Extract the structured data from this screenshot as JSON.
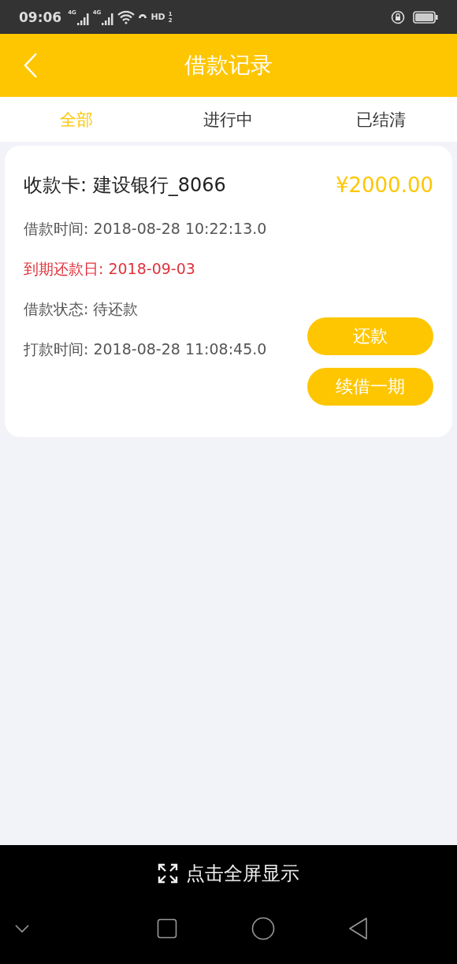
{
  "status_bar": {
    "time": "09:06",
    "signals": [
      "4G",
      "4G"
    ],
    "hd": "HD",
    "hd_slots": [
      "1",
      "2"
    ]
  },
  "header": {
    "title": "借款记录"
  },
  "tabs": [
    {
      "label": "全部",
      "selected": true
    },
    {
      "label": "进行中",
      "selected": false
    },
    {
      "label": "已结清",
      "selected": false
    }
  ],
  "loans": [
    {
      "card": "收款卡: 建设银行_8066",
      "amount": "¥2000.00",
      "details": [
        {
          "kind": "plain",
          "text": "借款时间: 2018-08-28 10:22:13.0"
        },
        {
          "kind": "due",
          "text": "到期还款日: 2018-09-03"
        },
        {
          "kind": "plain",
          "text": "借款状态: 待还款"
        },
        {
          "kind": "plain",
          "text": "打款时间: 2018-08-28 11:08:45.0"
        }
      ],
      "actions": [
        "还款",
        "续借一期"
      ]
    }
  ],
  "fullscreen_bar": {
    "label": "点击全屏显示"
  }
}
